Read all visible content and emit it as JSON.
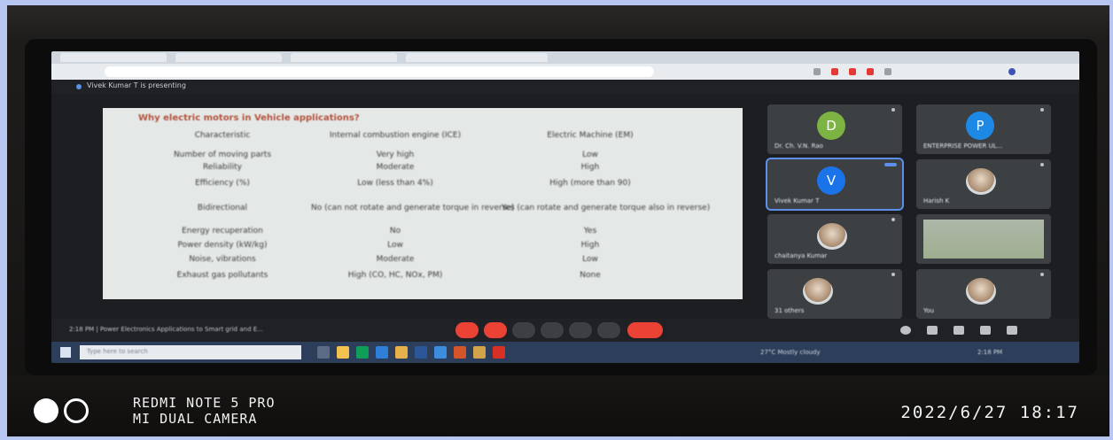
{
  "watermark": {
    "model": "REDMI NOTE 5 PRO",
    "camera": "MI DUAL CAMERA",
    "timestamp": "2022/6/27  18:17"
  },
  "meet": {
    "presenting_banner": "Vivek Kumar T is presenting",
    "meeting_info": "2:18 PM  |  Power Electronics Applications to Smart grid and E..."
  },
  "slide": {
    "title": "Why electric motors in Vehicle applications?",
    "columns": [
      "Characteristic",
      "Internal combustion engine (ICE)",
      "Electric Machine (EM)"
    ],
    "rows": [
      [
        "Number of moving parts",
        "Very high",
        "Low"
      ],
      [
        "Reliability",
        "Moderate",
        "High"
      ],
      [
        "Efficiency (%)",
        "Low (less than 4%)",
        "High (more than 90)"
      ],
      [
        "Bidirectional",
        "No (can not rotate and generate torque in reverse)",
        "Yes (can rotate and generate torque also in reverse)"
      ],
      [
        "Energy recuperation",
        "No",
        "Yes"
      ],
      [
        "Power density (kW/kg)",
        "Low",
        "High"
      ],
      [
        "Noise, vibrations",
        "Moderate",
        "Low"
      ],
      [
        "Exhaust gas pollutants",
        "High (CO, HC, NOx, PM)",
        "None"
      ]
    ]
  },
  "participants": [
    {
      "name": "Dr. Ch. V.N. Rao",
      "initial": "D",
      "color": "#7cb342"
    },
    {
      "name": "ENTERPRISE POWER UL...",
      "initial": "P",
      "color": "#1e88e5"
    },
    {
      "name": "Vivek Kumar T",
      "initial": "V",
      "color": "#1a73e8"
    },
    {
      "name": "Harish K",
      "initial": "",
      "color": "#3c4043"
    },
    {
      "name": "chaitanya Kumar",
      "initial": "",
      "color": "#3c4043"
    },
    {
      "name": "",
      "initial": "",
      "color": "#3c4043"
    },
    {
      "name": "31 others",
      "initial": "",
      "color": "#3c4043"
    },
    {
      "name": "You",
      "initial": "",
      "color": "#3c4043"
    }
  ],
  "taskbar": {
    "search_placeholder": "Type here to search",
    "tray": "27°C  Mostly cloudy",
    "time": "2:18 PM"
  }
}
